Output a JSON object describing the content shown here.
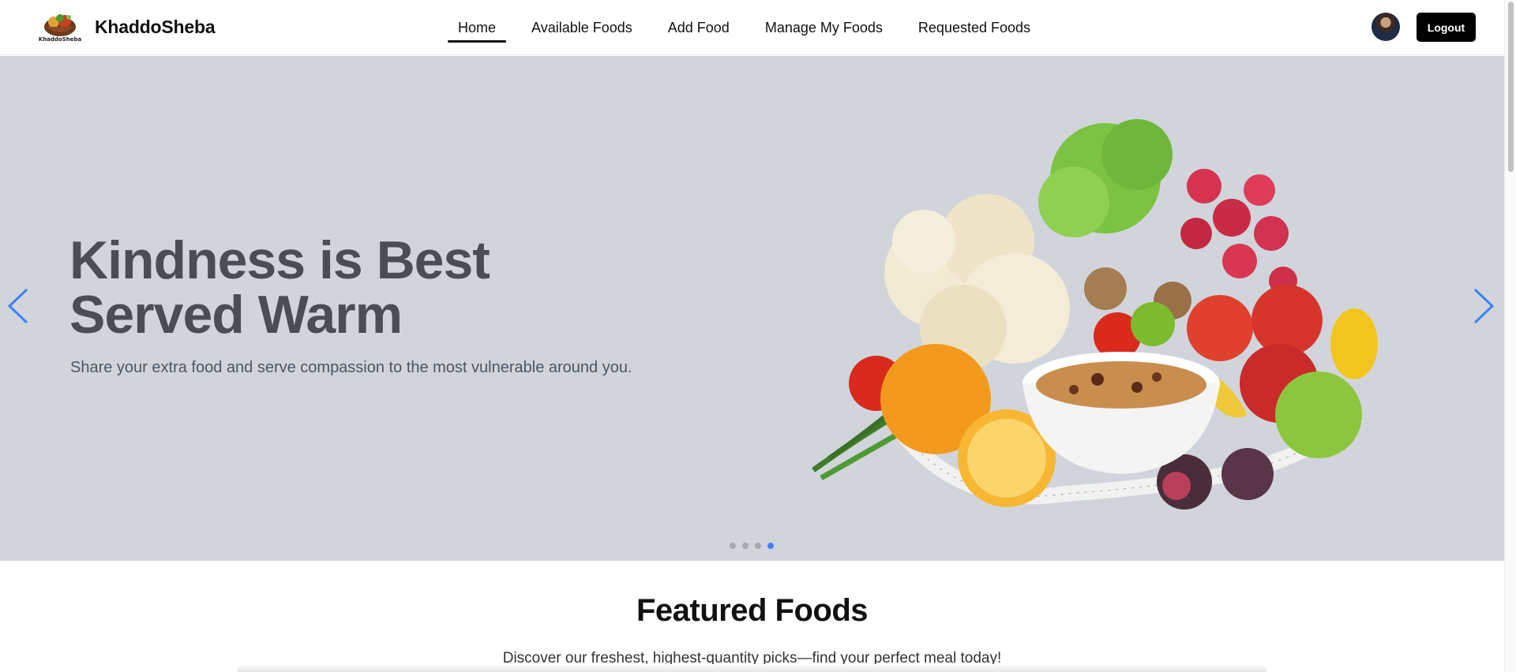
{
  "brand": {
    "name": "KhaddoSheba",
    "logo_text": "KhaddoSheba"
  },
  "nav": {
    "items": [
      {
        "label": "Home",
        "active": true
      },
      {
        "label": "Available Foods",
        "active": false
      },
      {
        "label": "Add Food",
        "active": false
      },
      {
        "label": "Manage My Foods",
        "active": false
      },
      {
        "label": "Requested Foods",
        "active": false
      }
    ],
    "logout_label": "Logout"
  },
  "hero": {
    "title_line1": "Kindness is Best",
    "title_line2": "Served Warm",
    "subtitle": "Share your extra food and serve compassion to the most vulnerable around you.",
    "slides_count": 4,
    "active_slide": 4,
    "background_color": "#d1d5db",
    "arrow_color": "#3b82f6"
  },
  "featured": {
    "title": "Featured Foods",
    "subtitle": "Discover our freshest, highest-quantity picks—find your perfect meal today!"
  }
}
